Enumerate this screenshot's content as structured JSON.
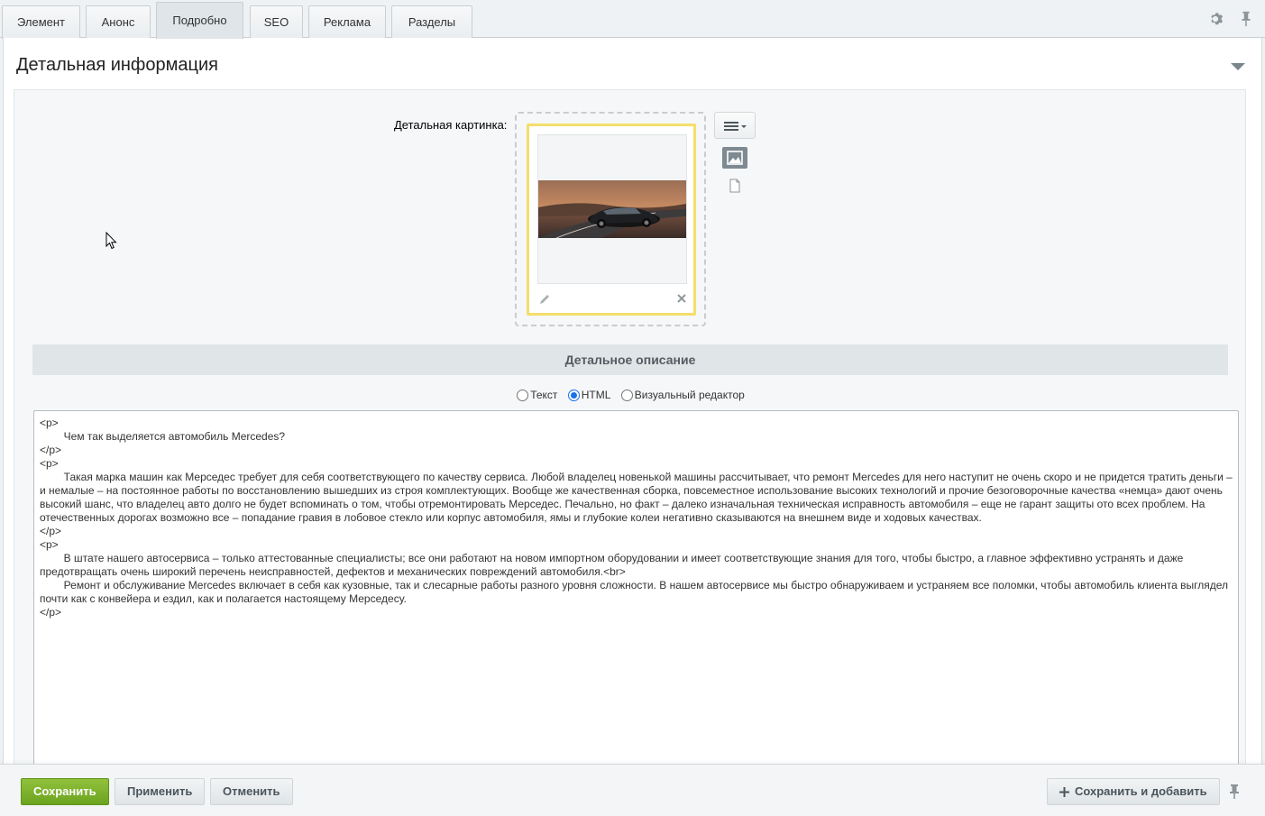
{
  "tabs": [
    {
      "label": "Элемент",
      "active": false
    },
    {
      "label": "Анонс",
      "active": false
    },
    {
      "label": "Подробно",
      "active": true
    },
    {
      "label": "SEO",
      "active": false
    },
    {
      "label": "Реклама",
      "active": false
    },
    {
      "label": "Разделы",
      "active": false
    }
  ],
  "toolbar_icons": [
    "gear-icon",
    "pin-icon"
  ],
  "section": {
    "title": "Детальная информация",
    "collapse_icon": "chevron-down-icon"
  },
  "detail_image": {
    "label": "Детальная картинка:",
    "photo_alt": "black Mercedes car on a road",
    "actions": [
      "pencil-icon",
      "close-icon"
    ]
  },
  "side_tools": [
    "menu-dropdown-icon",
    "image-icon",
    "file-icon"
  ],
  "description": {
    "header": "Детальное описание",
    "modes": [
      {
        "label": "Текст",
        "checked": false
      },
      {
        "label": "HTML",
        "checked": true
      },
      {
        "label": "Визуальный редактор",
        "checked": false
      }
    ],
    "content": "<p>\n\tЧем так выделяется автомобиль Mercedes?\n</p>\n<p>\n\tТакая марка машин как Мерседес требует для себя соответствующего по качеству сервиса. Любой владелец новенькой машины рассчитывает, что ремонт Mercedes для него наступит не очень скоро и не придется тратить деньги – и немалые – на постоянное работы по восстановлению вышедших из строя комплектующих. Вообще же качественная сборка, повсеместное использование высоких технологий и прочие безоговорочные качества «немца» дают очень высокий шанс, что владелец авто долго не будет вспоминать о том, чтобы отремонтировать Мерседес. Печально, но факт – далеко изначальная техническая исправность автомобиля – еще не гарант защиты ото всех проблем. На отечественных дорогах возможно все – попадание гравия в лобовое стекло или корпус автомобиля, ямы и глубокие колеи негативно сказываются на внешнем виде и ходовых качествах.\n</p>\n<p>\n\tВ штате нашего автосервиса – только аттестованные специалисты; все они работают на новом импортном оборудовании и имеет соответствующие знания для того, чтобы быстро, а главное эффективно устранять и даже предотвращать очень широкий перечень неисправностей, дефектов и механических повреждений автомобиля.<br>\n\tРемонт и обслуживание Mercedes включает в себя как кузовные, так и слесарные работы разного уровня сложности. В нашем автосервисе мы быстро обнаруживаем и устраняем все поломки, чтобы автомобиль клиента выглядел почти как с конвейера и ездил, как и полагается настоящему Мерседесу.\n</p>"
  },
  "footer": {
    "save": "Сохранить",
    "apply": "Применить",
    "cancel": "Отменить",
    "save_add": "Сохранить и добавить"
  },
  "colors": {
    "save_button": "#6aa320",
    "image_frame_highlight": "#f5de6a",
    "radio_checked": "#1a73e8"
  }
}
